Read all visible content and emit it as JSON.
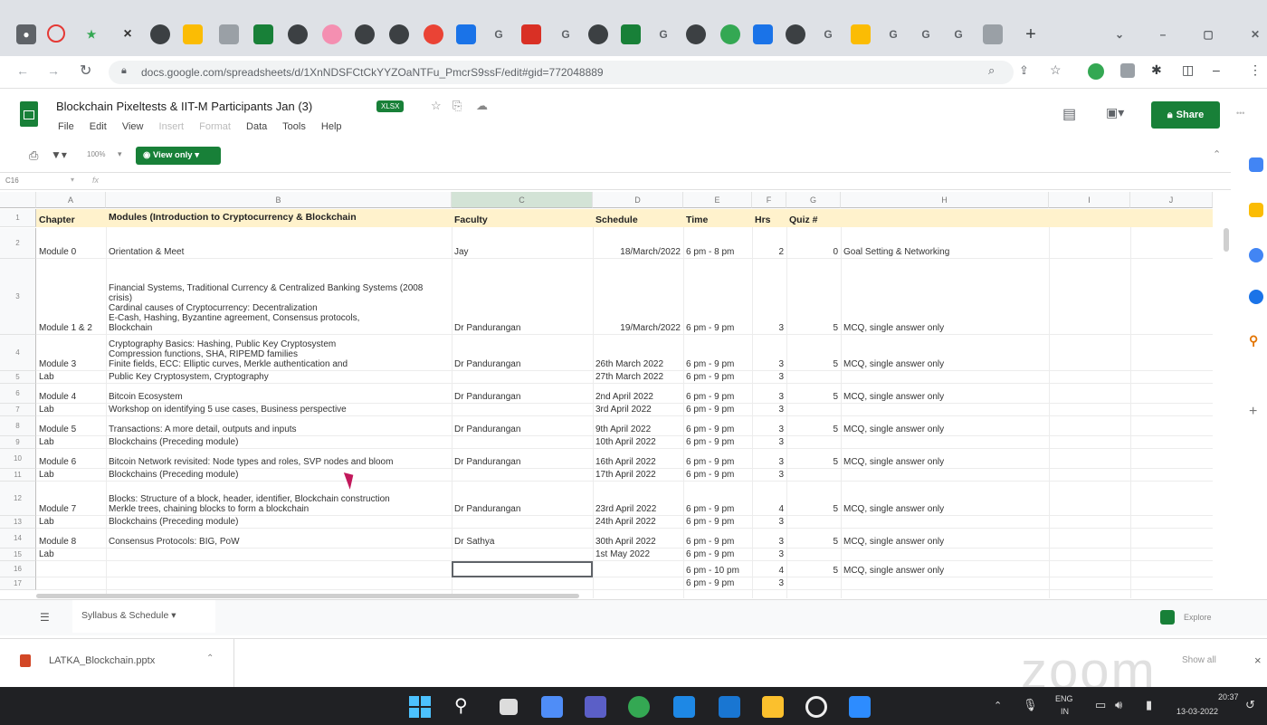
{
  "browser": {
    "url": "docs.google.com/spreadsheets/d/1XnNDSFCtCkYYZOaNTFu_PmcrS9ssF/edit#gid=772048889",
    "new_tab_symbol": "+",
    "tab_close": "×"
  },
  "doc": {
    "title": "Blockchain Pixeltests & IIT-M Participants Jan (3)",
    "badge": "XLSX",
    "menu": [
      "File",
      "Edit",
      "View",
      "Insert",
      "Format",
      "Data",
      "Tools",
      "Help"
    ],
    "share_label": "Share",
    "view_only_label": "View only",
    "zoom": "100%",
    "cell_ref": "C16",
    "colors": {
      "green": "#188038",
      "header_yellow": "#fff2cc"
    }
  },
  "columns": [
    "A",
    "B",
    "C",
    "D",
    "E",
    "F",
    "G",
    "H",
    "I",
    "J"
  ],
  "headers": [
    "Chapter",
    "Modules (Introduction to Cryptocurrency & Blockchain",
    "Faculty",
    "Schedule",
    "Time",
    "Hrs",
    "Quiz #"
  ],
  "rows": [
    {
      "n": "2",
      "chapter": "Module 0",
      "module": "Orientation & Meet",
      "faculty": "Jay",
      "schedule": "18/March/2022",
      "time": "6 pm - 8 pm",
      "hrs": "2",
      "quiz": "0",
      "type": "Goal Setting & Networking"
    },
    {
      "n": "3",
      "chapter": "Module 1 & 2",
      "module": "Financial Systems, Traditional Currency & Centralized Banking Systems (2008 crisis)\nCardinal causes of Cryptocurrency: Decentralization\nE-Cash, Hashing, Byzantine agreement, Consensus protocols,\nBlockchain",
      "faculty": "Dr Pandurangan",
      "schedule": "19/March/2022",
      "time": "6 pm - 9 pm",
      "hrs": "3",
      "quiz": "5",
      "type": "MCQ, single answer only"
    },
    {
      "n": "4",
      "chapter": "Module 3",
      "module": "Cryptography Basics: Hashing, Public Key Cryptosystem\nCompression functions, SHA, RIPEMD families\nFinite fields, ECC: Elliptic curves, Merkle authentication and",
      "faculty": "Dr Pandurangan",
      "schedule": "26th March 2022",
      "time": "6 pm - 9 pm",
      "hrs": "3",
      "quiz": "5",
      "type": "MCQ, single answer only"
    },
    {
      "n": "5",
      "chapter": "Lab",
      "module": "Public Key Cryptosystem, Cryptography",
      "faculty": "",
      "schedule": "27th March 2022",
      "time": "6 pm - 9 pm",
      "hrs": "3",
      "quiz": "",
      "type": ""
    },
    {
      "n": "6",
      "chapter": "Module 4",
      "module": "Bitcoin Ecosystem",
      "faculty": "Dr Pandurangan",
      "schedule": "2nd April 2022",
      "time": "6 pm - 9 pm",
      "hrs": "3",
      "quiz": "5",
      "type": "MCQ, single answer only"
    },
    {
      "n": "7",
      "chapter": "Lab",
      "module": "Workshop on identifying 5 use cases, Business perspective",
      "faculty": "",
      "schedule": "3rd April 2022",
      "time": "6 pm - 9 pm",
      "hrs": "3",
      "quiz": "",
      "type": ""
    },
    {
      "n": "8",
      "chapter": "Module 5",
      "module": "Transactions: A more detail, outputs and inputs",
      "faculty": "Dr Pandurangan",
      "schedule": "9th April 2022",
      "time": "6 pm - 9 pm",
      "hrs": "3",
      "quiz": "5",
      "type": "MCQ, single answer only"
    },
    {
      "n": "9",
      "chapter": "Lab",
      "module": "Blockchains (Preceding module)",
      "faculty": "",
      "schedule": "10th April 2022",
      "time": "6 pm - 9 pm",
      "hrs": "3",
      "quiz": "",
      "type": ""
    },
    {
      "n": "10",
      "chapter": "Module 6",
      "module": "Bitcoin Network revisited: Node types and roles, SVP nodes and bloom",
      "faculty": "Dr Pandurangan",
      "schedule": "16th April 2022",
      "time": "6 pm - 9 pm",
      "hrs": "3",
      "quiz": "5",
      "type": "MCQ, single answer only"
    },
    {
      "n": "11",
      "chapter": "Lab",
      "module": "Blockchains (Preceding module)",
      "faculty": "",
      "schedule": "17th April 2022",
      "time": "6 pm - 9 pm",
      "hrs": "3",
      "quiz": "",
      "type": ""
    },
    {
      "n": "12",
      "chapter": "Module 7",
      "module": "Blocks: Structure of a block, header, identifier, Blockchain construction\nMerkle trees, chaining blocks to form a blockchain",
      "faculty": "Dr Pandurangan",
      "schedule": "23rd April 2022",
      "time": "6 pm - 9 pm",
      "hrs": "4",
      "quiz": "5",
      "type": "MCQ, single answer only"
    },
    {
      "n": "13",
      "chapter": "Lab",
      "module": "Blockchains (Preceding module)",
      "faculty": "",
      "schedule": "24th April 2022",
      "time": "6 pm - 9 pm",
      "hrs": "3",
      "quiz": "",
      "type": ""
    },
    {
      "n": "14",
      "chapter": "Module 8",
      "module": "Consensus Protocols: BIG, PoW",
      "faculty": "Dr Sathya",
      "schedule": "30th April 2022",
      "time": "6 pm - 9 pm",
      "hrs": "3",
      "quiz": "5",
      "type": "MCQ, single answer only"
    },
    {
      "n": "15",
      "chapter": "Lab",
      "module": "",
      "faculty": "",
      "schedule": "1st May 2022",
      "time": "6 pm - 9 pm",
      "hrs": "3",
      "quiz": "",
      "type": ""
    },
    {
      "n": "16",
      "chapter": "",
      "module": "",
      "faculty": "",
      "schedule": "",
      "time": "6 pm - 10 pm",
      "hrs": "4",
      "quiz": "5",
      "type": "MCQ, single answer only"
    },
    {
      "n": "17",
      "chapter": "",
      "module": "",
      "faculty": "",
      "schedule": "",
      "time": "6 pm - 9 pm",
      "hrs": "3",
      "quiz": "",
      "type": ""
    }
  ],
  "sheet_tab": "Syllabus & Schedule",
  "explore_label": "Explore",
  "download": {
    "file": "LATKA_Blockchain.pptx",
    "show_all": "Show all",
    "close": "×"
  },
  "zoom_watermark": "zoom",
  "taskbar": {
    "lang": "ENG",
    "lang2": "IN",
    "time": "20:37",
    "date": "13-03-2022"
  }
}
